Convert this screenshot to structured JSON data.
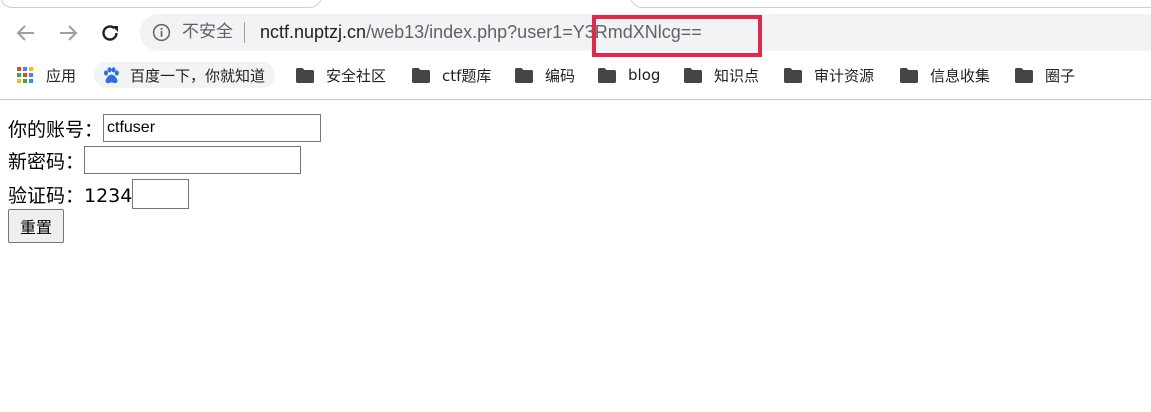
{
  "browser": {
    "security_label": "不安全",
    "url_host": "nctf.nuptzj.cn",
    "url_path": "/web13/index.php?user1=Y3RmdXNlcg==",
    "bookmarks": [
      {
        "label": "应用",
        "icon": "apps-grid-icon"
      },
      {
        "label": "百度一下，你就知道",
        "icon": "baidu-paw-icon"
      },
      {
        "label": "安全社区",
        "icon": "folder-icon"
      },
      {
        "label": "ctf题库",
        "icon": "folder-icon"
      },
      {
        "label": "编码",
        "icon": "folder-icon"
      },
      {
        "label": "blog",
        "icon": "folder-icon"
      },
      {
        "label": "知识点",
        "icon": "folder-icon"
      },
      {
        "label": "审计资源",
        "icon": "folder-icon"
      },
      {
        "label": "信息收集",
        "icon": "folder-icon"
      },
      {
        "label": "圈子",
        "icon": "folder-icon"
      }
    ],
    "highlight_color": "#e8264a"
  },
  "form": {
    "account_label": "你的账号：",
    "account_value": "ctfuser",
    "new_password_label": "新密码：",
    "new_password_value": "",
    "captcha_label": "验证码：1234",
    "captcha_value": "",
    "reset_button": "重置"
  }
}
